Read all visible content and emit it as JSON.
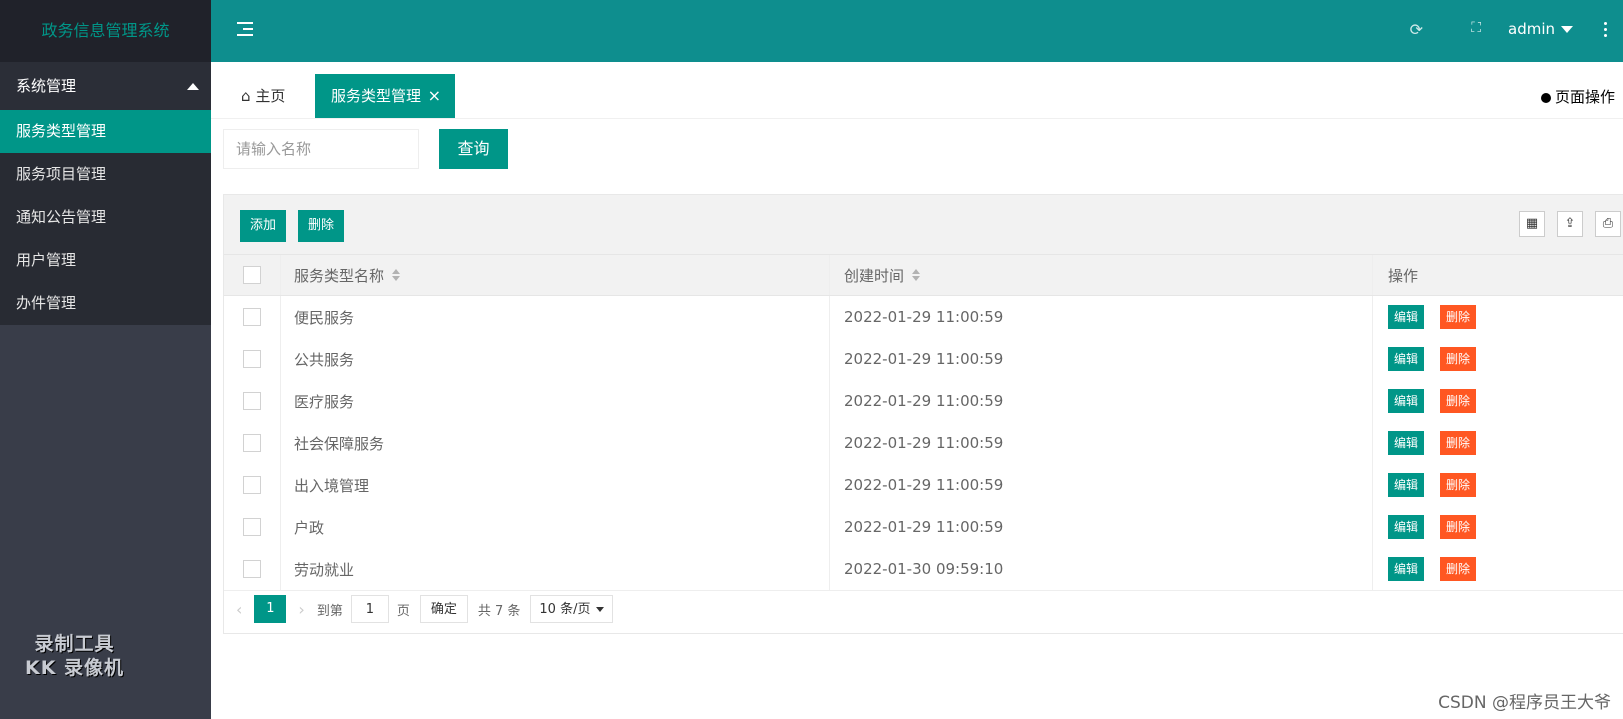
{
  "colors": {
    "primary": "#009688",
    "header": "#0e8e8e",
    "sidebar": "#393d49",
    "danger": "#ff5722"
  },
  "app": {
    "title": "政务信息管理系统"
  },
  "sidebar": {
    "group_label": "系统管理",
    "items": [
      {
        "label": "服务类型管理",
        "active": true
      },
      {
        "label": "服务项目管理"
      },
      {
        "label": "通知公告管理"
      },
      {
        "label": "用户管理"
      },
      {
        "label": "办件管理"
      }
    ]
  },
  "watermark": {
    "line1": "录制工具",
    "line2": "KK 录像机"
  },
  "header": {
    "user": "admin",
    "icons": [
      "menu-toggle-icon",
      "refresh-icon",
      "fullscreen-icon",
      "more-vertical-icon"
    ]
  },
  "tabs": {
    "home_label": "主页",
    "active_label": "服务类型管理",
    "close_glyph": "×",
    "page_ops_label": "页面操作"
  },
  "search": {
    "placeholder": "请输入名称",
    "button_label": "查询"
  },
  "toolbar": {
    "add_label": "添加",
    "delete_label": "删除",
    "icons": [
      "columns-icon",
      "export-icon",
      "print-icon"
    ]
  },
  "table": {
    "columns": [
      "服务类型名称",
      "创建时间",
      "操作"
    ],
    "edit_label": "编辑",
    "delete_label": "删除",
    "rows": [
      {
        "name": "便民服务",
        "time": "2022-01-29 11:00:59"
      },
      {
        "name": "公共服务",
        "time": "2022-01-29 11:00:59"
      },
      {
        "name": "医疗服务",
        "time": "2022-01-29 11:00:59"
      },
      {
        "name": "社会保障服务",
        "time": "2022-01-29 11:00:59"
      },
      {
        "name": "出入境管理",
        "time": "2022-01-29 11:00:59"
      },
      {
        "name": "户政",
        "time": "2022-01-29 11:00:59"
      },
      {
        "name": "劳动就业",
        "time": "2022-01-30 09:59:10"
      }
    ]
  },
  "pagination": {
    "current": "1",
    "goto_prefix": "到第",
    "goto_value": "1",
    "goto_suffix": "页",
    "confirm_label": "确定",
    "total_text": "共 7 条",
    "page_size": "10 条/页"
  },
  "footer": {
    "watermark": "CSDN @程序员王大爷"
  }
}
